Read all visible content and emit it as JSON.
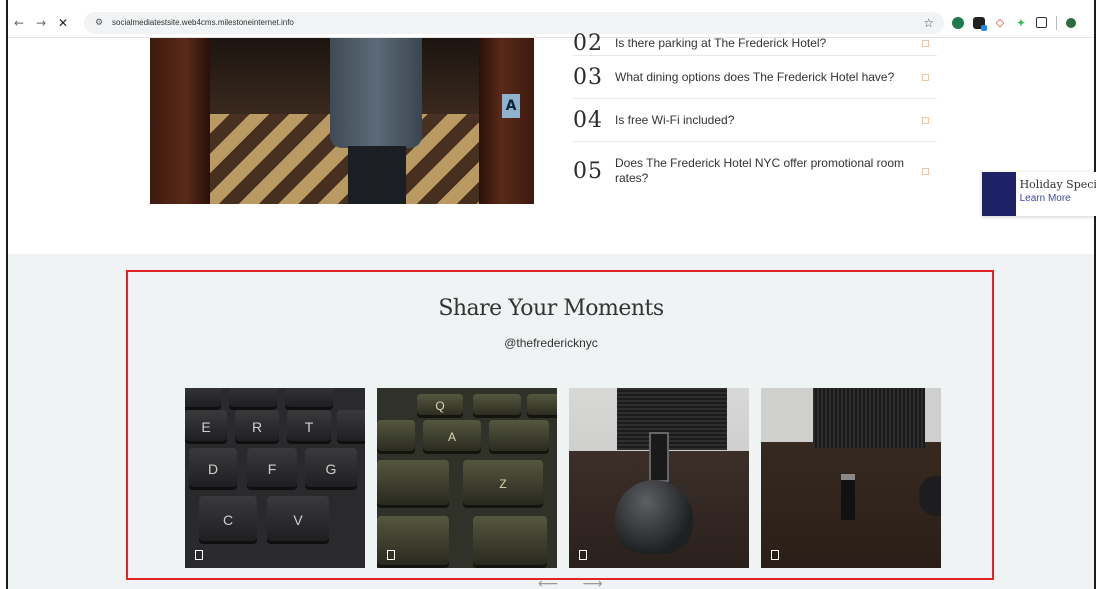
{
  "browser": {
    "url": "socialmediatestsite.web4cms.milestoneinternet.info",
    "back_icon": "←",
    "forward_icon": "→",
    "close_icon": "✕",
    "star_icon": "☆"
  },
  "faq": {
    "items": [
      {
        "num": "02",
        "question": "Is there parking at The Frederick Hotel?"
      },
      {
        "num": "03",
        "question": "What dining options does The Frederick Hotel have?"
      },
      {
        "num": "04",
        "question": "Is free Wi-Fi included?"
      },
      {
        "num": "05",
        "question": "Does The Frederick Hotel NYC offer promotional room rates?"
      }
    ]
  },
  "holiday_banner": {
    "title": "Holiday Speci",
    "link": "Learn More"
  },
  "moments": {
    "title": "Share Your Moments",
    "handle": "@thefredericknyc",
    "arrows": "⟵ ⟶",
    "highlight_color": "#e02424"
  },
  "keys": {
    "p1": [
      "E",
      "R",
      "T",
      "D",
      "F",
      "G",
      "C",
      "V"
    ],
    "p2": [
      "Q",
      "A",
      "Z"
    ]
  }
}
